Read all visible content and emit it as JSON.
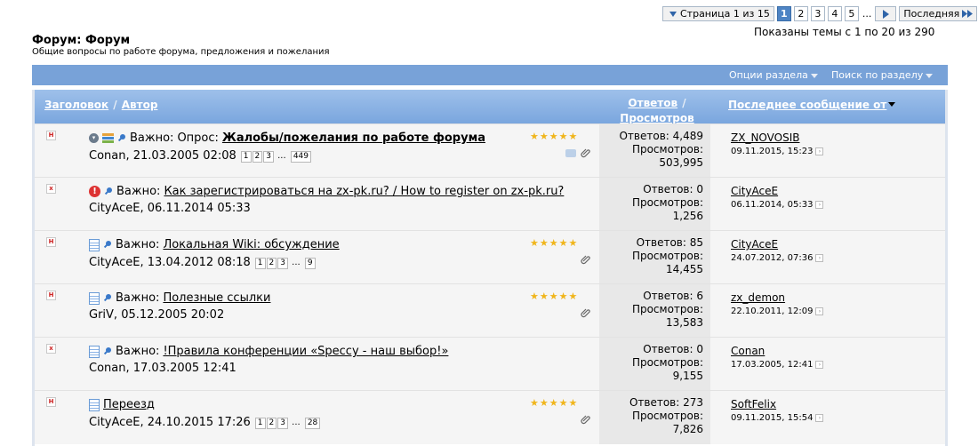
{
  "pagination": {
    "label": "Страница 1 из 15",
    "pages": [
      "1",
      "2",
      "3",
      "4",
      "5"
    ],
    "active": "1",
    "ellipsis": "...",
    "last_label": "Последняя"
  },
  "shown_text": "Показаны темы с 1 по 20 из 290",
  "forum": {
    "title": "Форум: Форум",
    "description": "Общие вопросы по работе форума, предложения и пожелания"
  },
  "options_bar": {
    "section_options": "Опции раздела",
    "search_section": "Поиск по разделу"
  },
  "table_header": {
    "title": "Заголовок",
    "sep": "/",
    "author": "Автор",
    "replies": "Ответов",
    "views": "Просмотров",
    "last_post": "Последнее сообщение от"
  },
  "threads": [
    {
      "status_mark": "H",
      "prefix": "Важно:",
      "poll_prefix": "Опрос:",
      "title": "Жалобы/пожелания по работе форума",
      "author_date": "Conan, 21.03.2005 02:08",
      "pages": [
        "1",
        "2",
        "3"
      ],
      "pages_last": "449",
      "rating": "★★★★★",
      "replies_text": "Ответов: 4,489",
      "views_label": "Просмотров:",
      "views": "503,995",
      "last_user": "ZX_NOVOSIB",
      "last_date": "09.11.2015, 15:23"
    },
    {
      "status_mark": "x",
      "prefix": "Важно:",
      "title": "Как зарегистрироваться на zx-pk.ru? / How to register on zx-pk.ru?",
      "author_date": "CityAceE, 06.11.2014 05:33",
      "replies_text": "Ответов: 0",
      "views_label": "Просмотров:",
      "views": "1,256",
      "last_user": "CityAceE",
      "last_date": "06.11.2014, 05:33"
    },
    {
      "status_mark": "H",
      "prefix": "Важно:",
      "title": "Локальная Wiki: обсуждение",
      "author_date": "CityAceE, 13.04.2012 08:18",
      "pages": [
        "1",
        "2",
        "3"
      ],
      "pages_last": "9",
      "rating": "★★★★★",
      "replies_text": "Ответов: 85",
      "views_label": "Просмотров:",
      "views": "14,455",
      "last_user": "CityAceE",
      "last_date": "24.07.2012, 07:36"
    },
    {
      "status_mark": "H",
      "prefix": "Важно:",
      "title": "Полезные ссылки",
      "author_date": "GriV, 05.12.2005 20:02",
      "rating": "★★★★★",
      "replies_text": "Ответов: 6",
      "views_label": "Просмотров:",
      "views": "13,583",
      "last_user": "zx_demon",
      "last_date": "22.10.2011, 12:09"
    },
    {
      "status_mark": "x",
      "prefix": "Важно:",
      "title": "!Правила конференции «Speccy - наш выбор!»",
      "author_date": "Conan, 17.03.2005 12:41",
      "replies_text": "Ответов: 0",
      "views_label": "Просмотров:",
      "views": "9,155",
      "last_user": "Conan",
      "last_date": "17.03.2005, 12:41"
    },
    {
      "status_mark": "H",
      "title": "Переезд",
      "author_date": "CityAceE, 24.10.2015 17:26",
      "pages": [
        "1",
        "2",
        "3"
      ],
      "pages_last": "28",
      "rating": "★★★★★",
      "replies_text": "Ответов: 273",
      "views_label": "Просмотров:",
      "views": "7,826",
      "last_user": "SoftFelix",
      "last_date": "09.11.2015, 15:54"
    }
  ]
}
